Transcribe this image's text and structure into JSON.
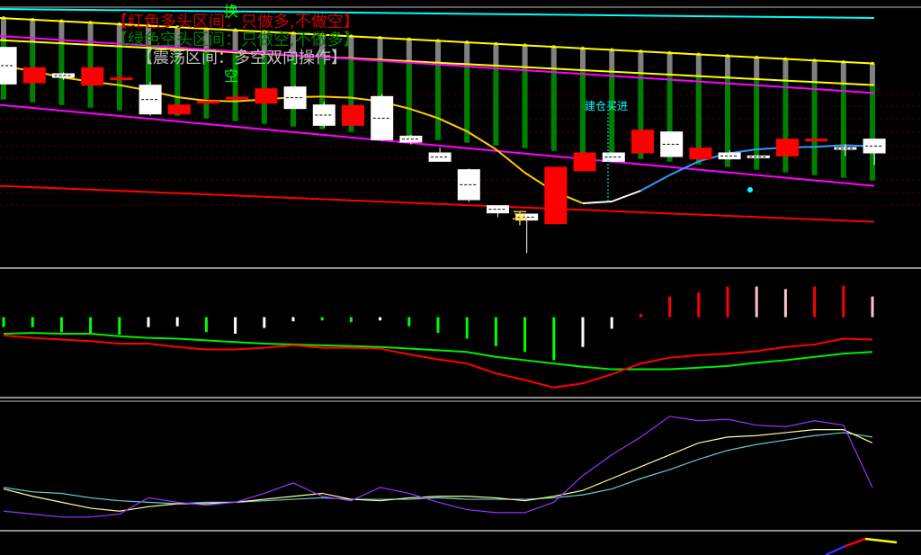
{
  "legend": {
    "bull": "【红色多头区间：只做多,不做空】",
    "bear": "【绿色空头区间：只做空,不做多】",
    "range": "【震荡区间：多空双向操作】"
  },
  "marks": {
    "buy_label": "建仓买进",
    "flat_label": "平",
    "kong_label": "空",
    "huan_label": "换"
  },
  "colors": {
    "background": "#000000",
    "bull_text": "#cc0000",
    "bear_text": "#008000",
    "range_text": "#c0c0c0",
    "up_candle": "#ff0000",
    "down_candle": "#ffffff",
    "bar_column": "#008000",
    "bar_column_top": "#808080",
    "channel_outer": "#ffff00",
    "channel_mid": "#ff00ff",
    "support": "#ff0000",
    "ma_down": "#ffcc00",
    "ma_up": "#3399ff",
    "cyan_line": "#00ffff",
    "buy_label": "#00ffff",
    "macd_green": "#00ff00",
    "macd_red": "#ff0000",
    "macd_white": "#ffffff",
    "macd_pink": "#ffc0cb",
    "kdj_k": "#ffff99",
    "kdj_d": "#66cccc",
    "kdj_j": "#9933ff"
  },
  "chart_data": [
    {
      "type": "candlestick",
      "panel": "price",
      "n_bars": 31,
      "candles": [
        {
          "o": 65.6,
          "h": 65.6,
          "c": 59.5,
          "l": 59.5
        },
        {
          "o": 59.7,
          "h": 60.1,
          "c": 62.2,
          "l": 62.2
        },
        {
          "o": 61.2,
          "h": 61.4,
          "c": 60.6,
          "l": 60.2
        },
        {
          "o": 59.3,
          "h": 60.8,
          "c": 62.2,
          "l": 62.3
        },
        {
          "o": 60.3,
          "h": 61.2,
          "c": 60.5,
          "l": 60.0
        },
        {
          "o": 59.3,
          "h": 59.8,
          "c": 54.5,
          "l": 54.2
        },
        {
          "o": 54.5,
          "h": 55.8,
          "c": 56.0,
          "l": 56.6
        },
        {
          "o": 56.4,
          "h": 57.4,
          "c": 56.6,
          "l": 56.5
        },
        {
          "o": 57.3,
          "h": 58.2,
          "c": 57.3,
          "l": 57.3
        },
        {
          "o": 56.3,
          "h": 58.5,
          "c": 58.7,
          "l": 58.7
        },
        {
          "o": 59.0,
          "h": 59.2,
          "c": 55.4,
          "l": 55.4
        },
        {
          "o": 56.0,
          "h": 56.5,
          "c": 52.6,
          "l": 52.2
        },
        {
          "o": 52.6,
          "h": 56.1,
          "c": 55.9,
          "l": 55.9
        },
        {
          "o": 57.4,
          "h": 57.8,
          "c": 50.2,
          "l": 50.0
        },
        {
          "o": 50.8,
          "h": 51.0,
          "c": 49.8,
          "l": 49.4
        },
        {
          "o": 48.0,
          "h": 48.9,
          "c": 46.6,
          "l": 46.6
        },
        {
          "o": 45.2,
          "h": 45.4,
          "c": 40.2,
          "l": 39.8
        },
        {
          "o": 39.2,
          "h": 39.2,
          "c": 38.0,
          "l": 37.3
        },
        {
          "o": 37.8,
          "h": 37.8,
          "c": 36.8,
          "l": 31.3
        },
        {
          "o": 36.2,
          "h": 45.6,
          "c": 45.6,
          "l": 36.2
        },
        {
          "o": 45.0,
          "h": 48.0,
          "c": 48.0,
          "l": 45.0
        },
        {
          "o": 48.0,
          "h": 47.9,
          "c": 46.6,
          "l": 46.5
        },
        {
          "o": 48.0,
          "h": 51.8,
          "c": 51.8,
          "l": 48.1
        },
        {
          "o": 51.5,
          "h": 51.5,
          "c": 47.4,
          "l": 47.4
        },
        {
          "o": 47.0,
          "h": 48.7,
          "c": 48.8,
          "l": 46.8
        },
        {
          "o": 48.0,
          "h": 48.4,
          "c": 47.0,
          "l": 46.9
        },
        {
          "o": 47.5,
          "h": 47.5,
          "c": 47.2,
          "l": 47.2
        },
        {
          "o": 47.5,
          "h": 50.3,
          "c": 50.3,
          "l": 47.5
        },
        {
          "o": 50.0,
          "h": 50.4,
          "c": 50.3,
          "l": 50.1
        },
        {
          "o": 48.9,
          "h": 49.4,
          "c": 48.6,
          "l": 47.5
        },
        {
          "o": 50.3,
          "h": 50.4,
          "c": 48.0,
          "l": 46.0
        }
      ],
      "ylim": [
        30,
        72
      ],
      "overlays": {
        "yellow_upper": {
          "start": 70.5,
          "end": 62.9
        },
        "yellow_lower": {
          "start": 66.8,
          "end": 59.3
        },
        "magenta_upper": {
          "start": 67.5,
          "end": 58.0
        },
        "magenta_lower": {
          "start": 56.0,
          "end": 42.5
        },
        "red_support": {
          "start": 42.5,
          "end": 36.5
        },
        "cyan_top": {
          "start": 72.0,
          "end": 70.5
        },
        "ma": [
          62.4,
          61.7,
          60.6,
          59.9,
          59.3,
          58.4,
          57.3,
          56.7,
          56.6,
          56.9,
          57.3,
          57.4,
          57.2,
          56.6,
          55.4,
          53.8,
          51.6,
          48.6,
          44.7,
          41.6,
          39.6,
          39.9,
          41.7,
          44.3,
          46.6,
          47.9,
          48.6,
          48.9,
          49.0,
          49.3,
          49.1
        ]
      }
    },
    {
      "type": "bar+line",
      "panel": "macd",
      "histogram": [
        {
          "v": -1.2,
          "c": "green"
        },
        {
          "v": -1.2,
          "c": "green"
        },
        {
          "v": -1.8,
          "c": "green"
        },
        {
          "v": -2.0,
          "c": "green"
        },
        {
          "v": -2.1,
          "c": "green"
        },
        {
          "v": -1.2,
          "c": "white"
        },
        {
          "v": -1.1,
          "c": "white"
        },
        {
          "v": -1.8,
          "c": "green"
        },
        {
          "v": -2.0,
          "c": "white"
        },
        {
          "v": -1.3,
          "c": "white"
        },
        {
          "v": -0.5,
          "c": "white"
        },
        {
          "v": -0.4,
          "c": "green"
        },
        {
          "v": -0.6,
          "c": "green"
        },
        {
          "v": -0.4,
          "c": "white"
        },
        {
          "v": -1.1,
          "c": "green"
        },
        {
          "v": -1.9,
          "c": "green"
        },
        {
          "v": -2.6,
          "c": "green"
        },
        {
          "v": -3.5,
          "c": "green"
        },
        {
          "v": -4.2,
          "c": "green"
        },
        {
          "v": -5.2,
          "c": "green"
        },
        {
          "v": -3.6,
          "c": "white"
        },
        {
          "v": -1.4,
          "c": "white"
        },
        {
          "v": 0.4,
          "c": "red"
        },
        {
          "v": 2.5,
          "c": "red"
        },
        {
          "v": 3.0,
          "c": "red"
        },
        {
          "v": 3.7,
          "c": "red"
        },
        {
          "v": 3.7,
          "c": "pink"
        },
        {
          "v": 3.4,
          "c": "pink"
        },
        {
          "v": 3.7,
          "c": "red"
        },
        {
          "v": 3.8,
          "c": "red"
        },
        {
          "v": 2.5,
          "c": "pink"
        }
      ],
      "dif": [
        -2.2,
        -2.5,
        -2.7,
        -2.9,
        -3.2,
        -3.2,
        -3.6,
        -3.9,
        -3.9,
        -3.7,
        -3.4,
        -3.7,
        -3.7,
        -3.8,
        -4.5,
        -5.1,
        -5.6,
        -6.8,
        -7.6,
        -8.5,
        -8.0,
        -6.9,
        -5.6,
        -4.9,
        -4.6,
        -4.4,
        -4.1,
        -3.6,
        -3.3,
        -2.6,
        -2.7
      ],
      "dea": [
        -2.0,
        -1.9,
        -2.0,
        -2.0,
        -2.3,
        -2.5,
        -2.6,
        -2.8,
        -3.0,
        -3.2,
        -3.3,
        -3.4,
        -3.5,
        -3.6,
        -3.8,
        -4.0,
        -4.2,
        -4.8,
        -5.2,
        -5.6,
        -6.0,
        -6.3,
        -6.3,
        -6.3,
        -6.1,
        -5.9,
        -5.5,
        -5.2,
        -4.8,
        -4.4,
        -4.2
      ],
      "ylim": [
        -9.5,
        5.5
      ]
    },
    {
      "type": "line",
      "panel": "kdj",
      "k": [
        47,
        42,
        38,
        34,
        32,
        35,
        37,
        37,
        38,
        40,
        42,
        44,
        40,
        39,
        41,
        42,
        42,
        41,
        39,
        42,
        46,
        54,
        62,
        70,
        78,
        82,
        83,
        85,
        87,
        87,
        78
      ],
      "d": [
        48,
        45,
        44,
        41,
        39,
        38,
        37,
        38,
        38,
        39,
        40,
        41,
        40,
        40,
        40,
        41,
        40,
        40,
        40,
        41,
        43,
        47,
        54,
        60,
        67,
        73,
        77,
        80,
        83,
        85,
        82
      ],
      "j": [
        32,
        30,
        28,
        28,
        30,
        41,
        38,
        36,
        38,
        44,
        51,
        42,
        39,
        48,
        44,
        38,
        33,
        31,
        31,
        38,
        56,
        70,
        82,
        96,
        93,
        94,
        90,
        89,
        93,
        90,
        48
      ],
      "ylim": [
        20,
        105
      ]
    }
  ]
}
